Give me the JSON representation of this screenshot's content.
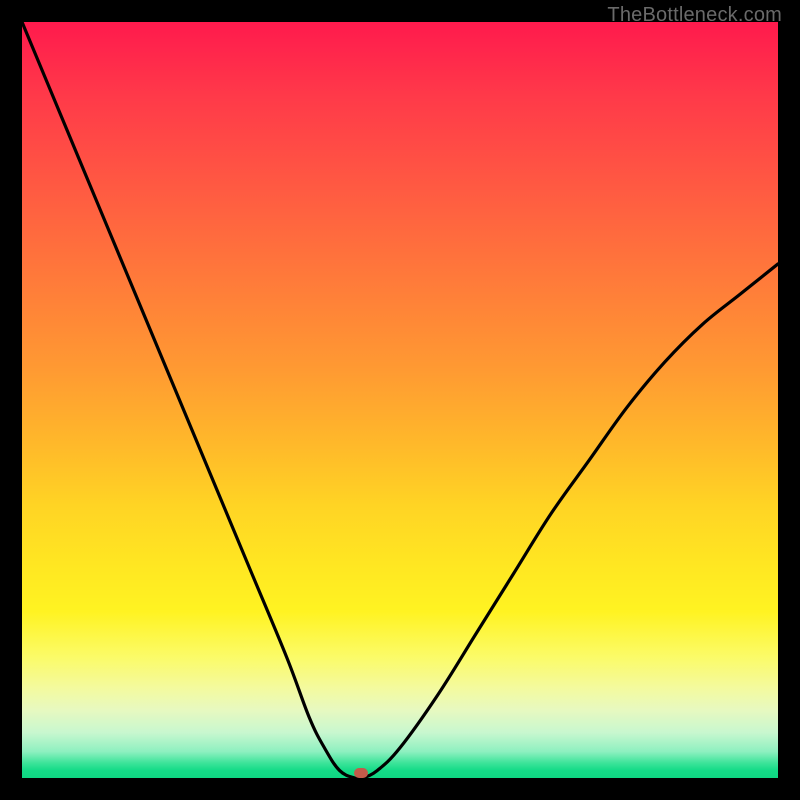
{
  "watermark": "TheBottleneck.com",
  "marker": {
    "x_frac": 0.448,
    "y_frac": 0.994
  },
  "chart_data": {
    "type": "line",
    "title": "",
    "xlabel": "",
    "ylabel": "",
    "xlim": [
      0,
      100
    ],
    "ylim": [
      0,
      100
    ],
    "grid": false,
    "series": [
      {
        "name": "bottleneck-curve",
        "x": [
          0,
          5,
          10,
          15,
          20,
          25,
          30,
          35,
          38,
          40,
          42,
          44,
          45,
          47,
          50,
          55,
          60,
          65,
          70,
          75,
          80,
          85,
          90,
          95,
          100
        ],
        "y": [
          100,
          88,
          76,
          64,
          52,
          40,
          28,
          16,
          8,
          4,
          1,
          0,
          0,
          1,
          4,
          11,
          19,
          27,
          35,
          42,
          49,
          55,
          60,
          64,
          68
        ]
      }
    ],
    "annotations": [
      {
        "type": "marker",
        "x": 44.8,
        "y": 0.6,
        "label": "optimal-point"
      }
    ],
    "background_gradient": {
      "direction": "vertical",
      "stops": [
        {
          "pos": 0.0,
          "color": "#ff1a4d"
        },
        {
          "pos": 0.46,
          "color": "#ff9a32"
        },
        {
          "pos": 0.78,
          "color": "#fff322"
        },
        {
          "pos": 0.94,
          "color": "#c8f7cf"
        },
        {
          "pos": 1.0,
          "color": "#0fd682"
        }
      ]
    }
  }
}
